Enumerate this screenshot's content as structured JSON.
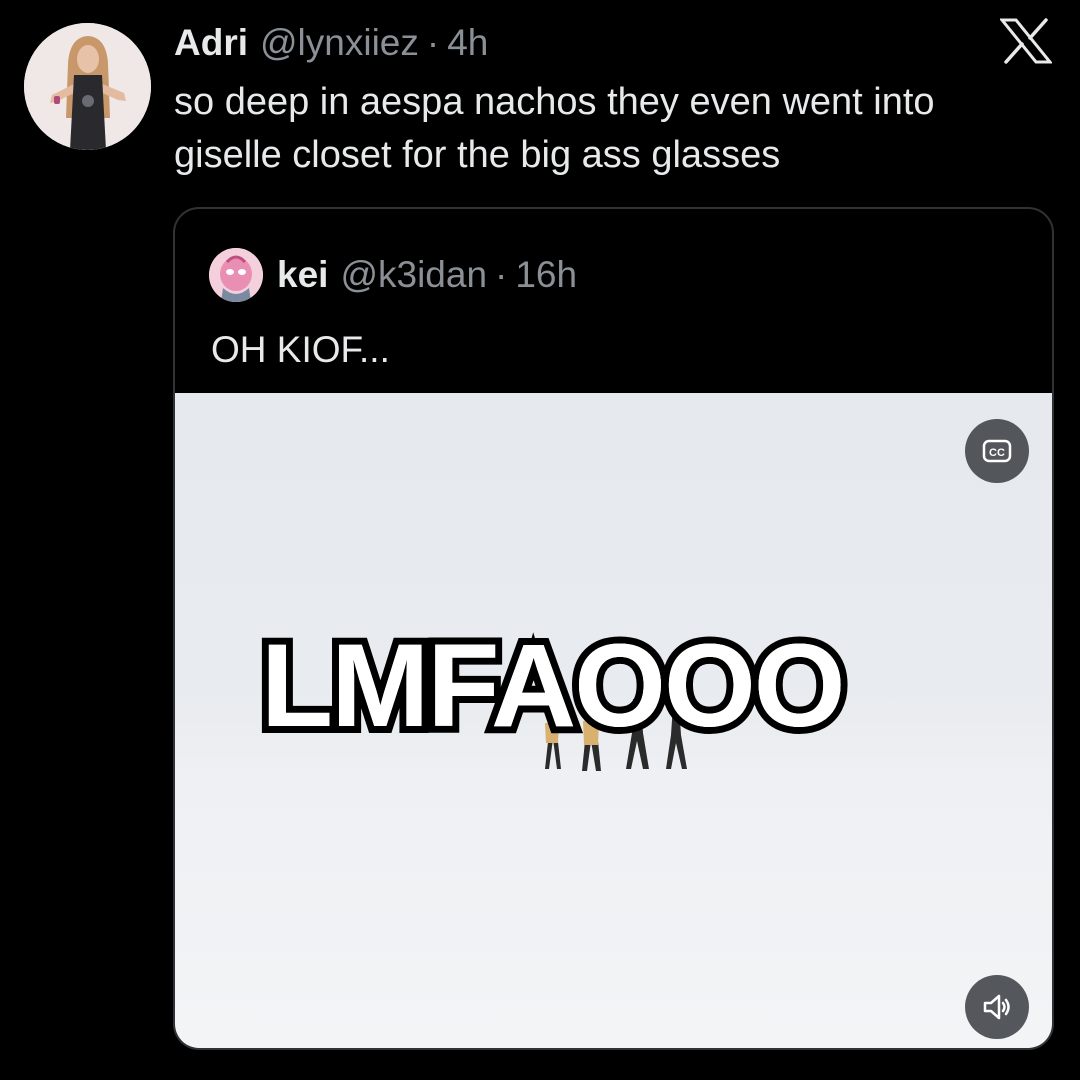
{
  "tweet": {
    "display_name": "Adri",
    "handle": "@lynxiiez",
    "separator": "·",
    "time": "4h",
    "text_lines": [
      "so deep in aespa nachos they even went into",
      "giselle closet for the big ass glasses"
    ]
  },
  "brand": {
    "logo_icon": "x-logo-icon"
  },
  "quote": {
    "display_name": "kei",
    "handle": "@k3idan",
    "separator": "·",
    "time": "16h",
    "text": "OH KIOF..."
  },
  "media": {
    "caption": "LMFAOOO",
    "captions_button_icon": "closed-captions-icon",
    "captions_button_label": "CC",
    "volume_button_icon": "speaker-muted-icon"
  },
  "colors": {
    "background": "#000000",
    "primary_text": "#e7e9ea",
    "secondary_text": "#8b9096",
    "card_border": "#2f3336",
    "media_background": "#e8ebef"
  }
}
